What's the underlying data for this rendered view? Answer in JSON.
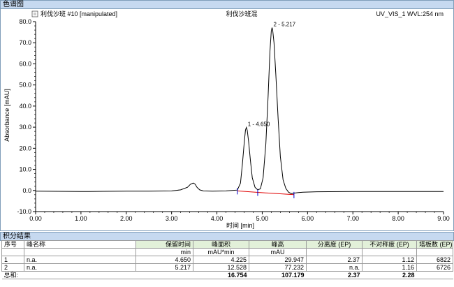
{
  "sections": {
    "chromatogram": "色谱图",
    "results": "积分结果"
  },
  "chart_header": {
    "left": "利伐沙班 #10 [manipulated]",
    "center": "利伐沙班混",
    "right": "UV_VIS_1 WVL:254 nm"
  },
  "chart_data": {
    "type": "line",
    "xlabel": "时间 [min]",
    "ylabel": "Absorbance [mAU]",
    "xlim": [
      0,
      9
    ],
    "ylim": [
      -10,
      80
    ],
    "x_ticks": [
      "0.00",
      "1.00",
      "2.00",
      "3.00",
      "4.00",
      "5.00",
      "6.00",
      "7.00",
      "8.00",
      "9.00"
    ],
    "y_ticks": [
      "-10.0",
      "0.0",
      "10.0",
      "20.0",
      "30.0",
      "40.0",
      "50.0",
      "60.0",
      "70.0",
      "80.0"
    ],
    "y_tick_values": [
      -10,
      0,
      10,
      20,
      30,
      40,
      50,
      60,
      70,
      80
    ],
    "trace_color": "#000000",
    "baseline_color": "#e00000",
    "marker_color": "#0000cc",
    "series": [
      {
        "x": [
          0.0,
          0.5,
          1.0,
          1.5,
          2.0,
          2.5,
          3.0,
          3.2,
          3.35,
          3.42,
          3.48,
          3.52,
          3.56,
          3.62,
          3.7,
          3.9,
          4.2,
          4.45,
          4.52,
          4.56,
          4.6,
          4.63,
          4.65,
          4.67,
          4.7,
          4.74,
          4.78,
          4.84,
          4.9,
          4.96,
          5.02,
          5.08,
          5.13,
          5.17,
          5.2,
          5.217,
          5.23,
          5.26,
          5.3,
          5.35,
          5.4,
          5.46,
          5.52,
          5.58,
          5.64,
          5.72,
          5.8,
          5.9,
          6.2,
          7.0,
          8.0,
          9.0
        ],
        "y": [
          -0.3,
          -0.4,
          -0.5,
          -0.4,
          -0.3,
          -0.3,
          -0.2,
          0.3,
          1.5,
          3.0,
          3.5,
          3.0,
          1.5,
          0.3,
          -0.2,
          -0.3,
          -0.2,
          0.2,
          3.5,
          12.0,
          22.0,
          28.5,
          29.9,
          28.5,
          23.0,
          14.0,
          6.0,
          1.5,
          0.3,
          0.8,
          6.0,
          22.0,
          45.0,
          66.0,
          75.5,
          77.2,
          76.0,
          70.0,
          55.0,
          34.0,
          16.0,
          5.0,
          1.0,
          -0.8,
          -1.5,
          -1.2,
          -1.0,
          -0.8,
          -0.6,
          -0.5,
          -0.5,
          -0.5
        ]
      }
    ],
    "peaks": [
      {
        "label": "1 - 4.650",
        "x": 4.65,
        "y": 29.947
      },
      {
        "label": "2 - 5.217",
        "x": 5.217,
        "y": 77.232
      }
    ],
    "integration_markers": [
      4.45,
      4.9,
      5.7
    ],
    "baseline": {
      "x": [
        4.45,
        4.9,
        5.7
      ],
      "y": [
        -0.2,
        -0.9,
        -2.0
      ]
    }
  },
  "table": {
    "headers": [
      "序号",
      "峰名称",
      "保留时间",
      "峰面积",
      "峰高",
      "分离度 (EP)",
      "不对称度 (EP)",
      "塔板数 (EP)"
    ],
    "units": [
      "",
      "",
      "min",
      "mAU*min",
      "mAU",
      "",
      "",
      ""
    ],
    "rows": [
      [
        "1",
        "n.a.",
        "4.650",
        "4.225",
        "29.947",
        "2.37",
        "1.12",
        "6822"
      ],
      [
        "2",
        "n.a.",
        "5.217",
        "12.528",
        "77.232",
        "n.a.",
        "1.16",
        "6726"
      ]
    ],
    "total": [
      "总和:",
      "",
      "",
      "16.754",
      "107.179",
      "2.37",
      "2.28",
      ""
    ]
  }
}
